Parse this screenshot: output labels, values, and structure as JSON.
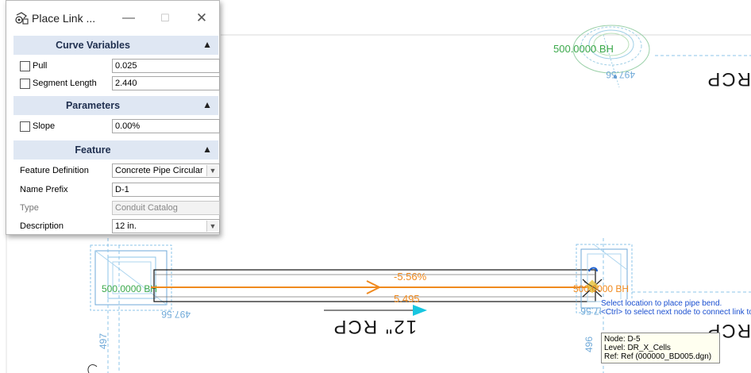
{
  "dialog": {
    "title": "Place Link ...",
    "icon": "place-link-tool-icon",
    "sections": {
      "curve_variables": "Curve Variables",
      "parameters": "Parameters",
      "feature": "Feature"
    },
    "fields": {
      "pull": {
        "label": "Pull",
        "value": "0.025"
      },
      "segment_length": {
        "label": "Segment Length",
        "value": "2.440"
      },
      "slope": {
        "label": "Slope",
        "value": "0.00%"
      },
      "feature_definition": {
        "label": "Feature Definition",
        "value": "Concrete Pipe Circular"
      },
      "name_prefix": {
        "label": "Name Prefix",
        "value": "D-1"
      },
      "type": {
        "label": "Type",
        "value": "Conduit Catalog"
      },
      "description": {
        "label": "Description",
        "value": "12 in."
      }
    }
  },
  "canvas": {
    "labels": {
      "top_elev": "500.0000 BH",
      "top_dim": "497.56",
      "top_rcp": "RCP",
      "left_elev": "500.0000 BH",
      "left_dim": "497.56",
      "left_small": "497",
      "slope": "-5.56%",
      "length": "5.495",
      "pipe": "12\" RCP",
      "right_elev": "500.0000 BH",
      "right_dim": "497.56",
      "right_small": "496",
      "right_rcp": "RCP"
    },
    "colors": {
      "pipe_orange": "#f08a1e",
      "arrow_cyan": "#18c6e0",
      "elev_green": "#3aa84a",
      "structure_blue": "#6fa9d8"
    }
  },
  "tooltips": {
    "prompt_line1": "Select location to place pipe bend.",
    "prompt_line2": "<Ctrl> to select next node to connect link to.",
    "node": "Node: D-5",
    "level": "Level: DR_X_Cells",
    "ref": "Ref: Ref (000000_BD005.dgn)"
  }
}
